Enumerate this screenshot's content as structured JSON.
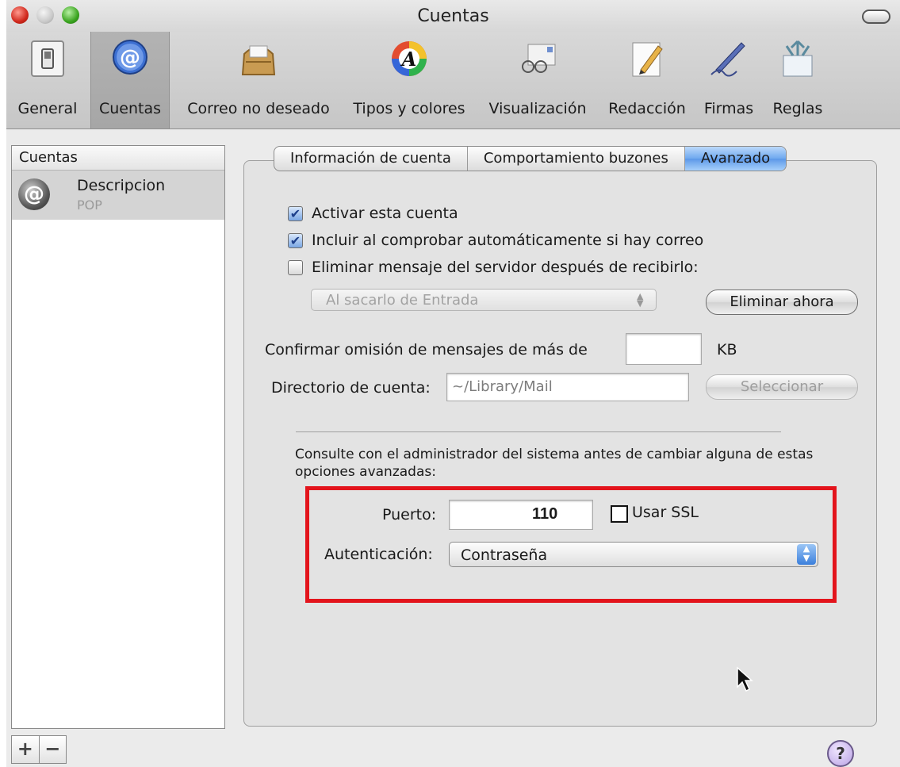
{
  "window": {
    "title": "Cuentas"
  },
  "toolbar": {
    "items": [
      {
        "label": "General",
        "icon": "light-switch-icon"
      },
      {
        "label": "Cuentas",
        "icon": "at-sign-icon",
        "selected": true
      },
      {
        "label": "Correo no deseado",
        "icon": "junk-mail-bag-icon"
      },
      {
        "label": "Tipos y colores",
        "icon": "font-color-wheel-icon"
      },
      {
        "label": "Visualización",
        "icon": "glasses-letter-icon"
      },
      {
        "label": "Redacción",
        "icon": "pencil-paper-icon"
      },
      {
        "label": "Firmas",
        "icon": "pen-signature-icon"
      },
      {
        "label": "Reglas",
        "icon": "rules-arrows-icon"
      }
    ]
  },
  "accounts": {
    "header": "Cuentas",
    "items": [
      {
        "name": "Descripcion",
        "type": "POP",
        "avatar_glyph": "@"
      }
    ],
    "add_label": "+",
    "remove_label": "−"
  },
  "tabs": [
    {
      "label": "Información de cuenta"
    },
    {
      "label": "Comportamiento buzones"
    },
    {
      "label": "Avanzado",
      "active": true
    }
  ],
  "advanced": {
    "enable_account": {
      "label": "Activar esta cuenta",
      "checked": true
    },
    "include_auto_check": {
      "label": "Incluir al comprobar automáticamente si hay correo",
      "checked": true
    },
    "delete_from_server": {
      "label": "Eliminar mensaje del servidor después de recibirlo:",
      "checked": false
    },
    "delete_when": "Al sacarlo de Entrada",
    "delete_now_button": "Eliminar ahora",
    "confirm_skip_label": "Confirmar omisión de mensajes de más de",
    "confirm_skip_value": "",
    "confirm_skip_unit": "KB",
    "account_dir_label": "Directorio de cuenta:",
    "account_dir_value": "~/Library/Mail",
    "select_button": "Seleccionar",
    "notice": "Consulte con el administrador del sistema antes de cambiar alguna de estas opciones avanzadas:",
    "port_label": "Puerto:",
    "port_value": "110",
    "ssl_label": "Usar SSL",
    "ssl_checked": false,
    "auth_label": "Autenticación:",
    "auth_value": "Contraseña"
  },
  "help_glyph": "?",
  "colors": {
    "highlight_box": "#e3141c",
    "active_tab": "#6ea8ef"
  }
}
